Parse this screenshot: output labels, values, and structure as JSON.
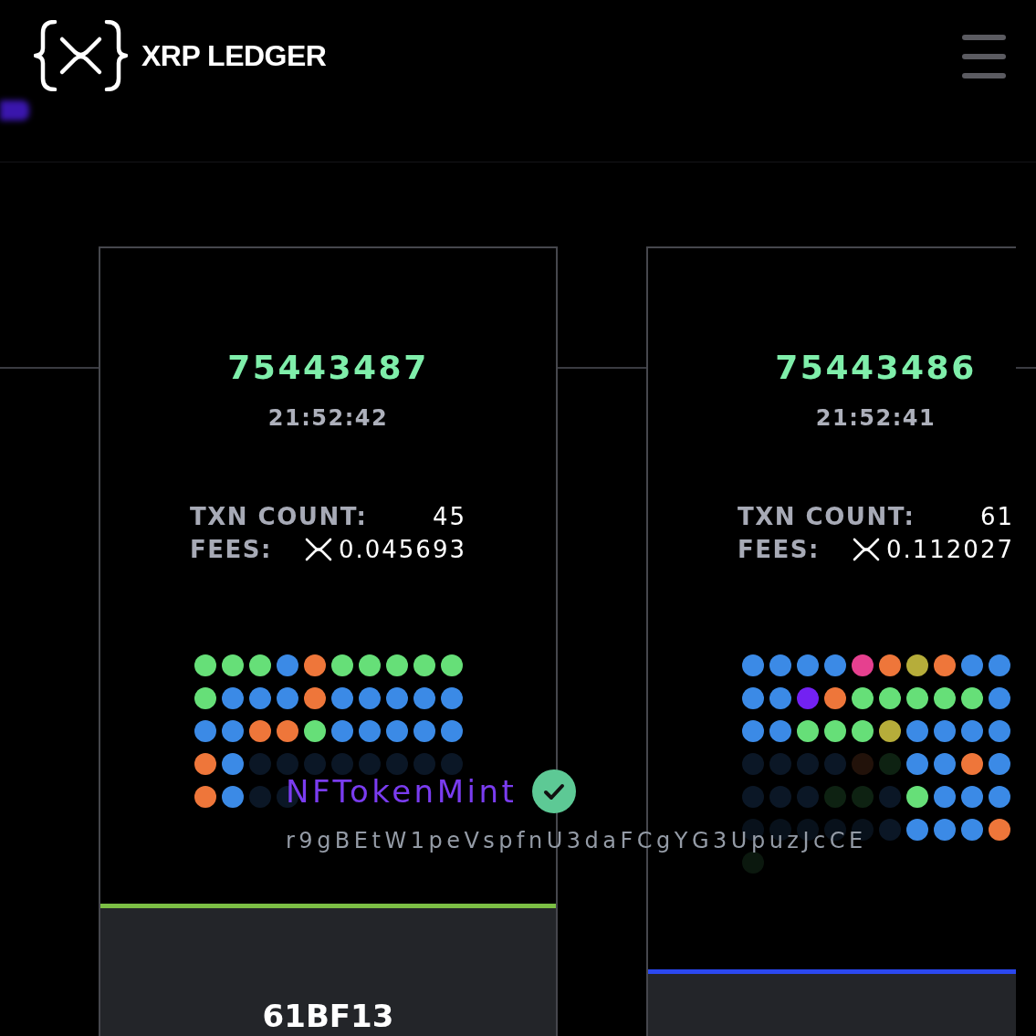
{
  "header": {
    "brand": "XRP LEDGER"
  },
  "ledgers": [
    {
      "index": "75443487",
      "time": "21:52:42",
      "stats": [
        {
          "kind": "count",
          "label": "TXN COUNT:",
          "value": "45"
        },
        {
          "kind": "fee",
          "label": "FEES:",
          "value": "0.045693"
        }
      ],
      "transactions": [
        {
          "color": "#66df78"
        },
        {
          "color": "#66df78"
        },
        {
          "color": "#66df78"
        },
        {
          "color": "#3b8ae6"
        },
        {
          "color": "#ee763a"
        },
        {
          "color": "#66df78"
        },
        {
          "color": "#66df78"
        },
        {
          "color": "#66df78"
        },
        {
          "color": "#66df78"
        },
        {
          "color": "#66df78"
        },
        {
          "color": "#66df78"
        },
        {
          "color": "#3b8ae6"
        },
        {
          "color": "#3b8ae6"
        },
        {
          "color": "#3b8ae6"
        },
        {
          "color": "#ee763a"
        },
        {
          "color": "#3b8ae6"
        },
        {
          "color": "#3b8ae6"
        },
        {
          "color": "#3b8ae6"
        },
        {
          "color": "#3b8ae6"
        },
        {
          "color": "#3b8ae6"
        },
        {
          "color": "#3b8ae6"
        },
        {
          "color": "#3b8ae6"
        },
        {
          "color": "#ee763a"
        },
        {
          "color": "#ee763a"
        },
        {
          "color": "#66df78"
        },
        {
          "color": "#3b8ae6"
        },
        {
          "color": "#3b8ae6"
        },
        {
          "color": "#3b8ae6"
        },
        {
          "color": "#3b8ae6"
        },
        {
          "color": "#3b8ae6"
        },
        {
          "color": "#ee763a"
        },
        {
          "color": "#3b8ae6"
        },
        {
          "color": "#0b1726"
        },
        {
          "color": "#0b1726"
        },
        {
          "color": "#0b1726"
        },
        {
          "color": "#0b1726"
        },
        {
          "color": "#0b1726"
        },
        {
          "color": "#0b1726"
        },
        {
          "color": "#0b1726"
        },
        {
          "color": "#0b1726"
        },
        {
          "color": "#ee763a"
        },
        {
          "color": "#3b8ae6"
        },
        {
          "color": "#0b1726"
        },
        {
          "color": "#0b1726"
        }
      ],
      "color": "#7cbf45",
      "hash": "61BF13"
    },
    {
      "index": "75443486",
      "time": "21:52:41",
      "stats": [
        {
          "kind": "count",
          "label": "TXN COUNT:",
          "value": "61"
        },
        {
          "kind": "fee",
          "label": "FEES:",
          "value": "0.112027"
        }
      ],
      "transactions": [
        {
          "color": "#3b8ae6"
        },
        {
          "color": "#3b8ae6"
        },
        {
          "color": "#3b8ae6"
        },
        {
          "color": "#3b8ae6"
        },
        {
          "color": "#e6408f"
        },
        {
          "color": "#ee763a"
        },
        {
          "color": "#b6ad3a"
        },
        {
          "color": "#ee763a"
        },
        {
          "color": "#3b8ae6"
        },
        {
          "color": "#3b8ae6"
        },
        {
          "color": "#3b8ae6"
        },
        {
          "color": "#3b8ae6"
        },
        {
          "color": "#7321f2"
        },
        {
          "color": "#ee763a"
        },
        {
          "color": "#66df78"
        },
        {
          "color": "#66df78"
        },
        {
          "color": "#66df78"
        },
        {
          "color": "#66df78"
        },
        {
          "color": "#66df78"
        },
        {
          "color": "#3b8ae6"
        },
        {
          "color": "#3b8ae6"
        },
        {
          "color": "#3b8ae6"
        },
        {
          "color": "#66df78"
        },
        {
          "color": "#66df78"
        },
        {
          "color": "#66df78"
        },
        {
          "color": "#b6ad3a"
        },
        {
          "color": "#3b8ae6"
        },
        {
          "color": "#3b8ae6"
        },
        {
          "color": "#3b8ae6"
        },
        {
          "color": "#3b8ae6"
        },
        {
          "color": "#0b1726"
        },
        {
          "color": "#0b1726"
        },
        {
          "color": "#0b1726"
        },
        {
          "color": "#0b1726"
        },
        {
          "color": "#22120a"
        },
        {
          "color": "#0e2212"
        },
        {
          "color": "#3b8ae6"
        },
        {
          "color": "#3b8ae6"
        },
        {
          "color": "#ee763a"
        },
        {
          "color": "#3b8ae6"
        },
        {
          "color": "#0b1726"
        },
        {
          "color": "#0b1726"
        },
        {
          "color": "#0b1726"
        },
        {
          "color": "#0e2212"
        },
        {
          "color": "#0e2212"
        },
        {
          "color": "#0b1726"
        },
        {
          "color": "#66df78"
        },
        {
          "color": "#3b8ae6"
        },
        {
          "color": "#3b8ae6"
        },
        {
          "color": "#3b8ae6"
        },
        {
          "color": "#08111b"
        },
        {
          "color": "#08111b"
        },
        {
          "color": "#08111b"
        },
        {
          "color": "#08111b"
        },
        {
          "color": "#08111b"
        },
        {
          "color": "#0b1726"
        },
        {
          "color": "#3b8ae6"
        },
        {
          "color": "#3b8ae6"
        },
        {
          "color": "#3b8ae6"
        },
        {
          "color": "#ee763a"
        },
        {
          "color": "#0b180e"
        }
      ],
      "color": "#2b48f0"
    }
  ],
  "tooltip": {
    "type": "NFTokenMint",
    "success": true,
    "account": "r9gBEtW1peVspfnU3daFCgYG3UpuzJcCE"
  }
}
